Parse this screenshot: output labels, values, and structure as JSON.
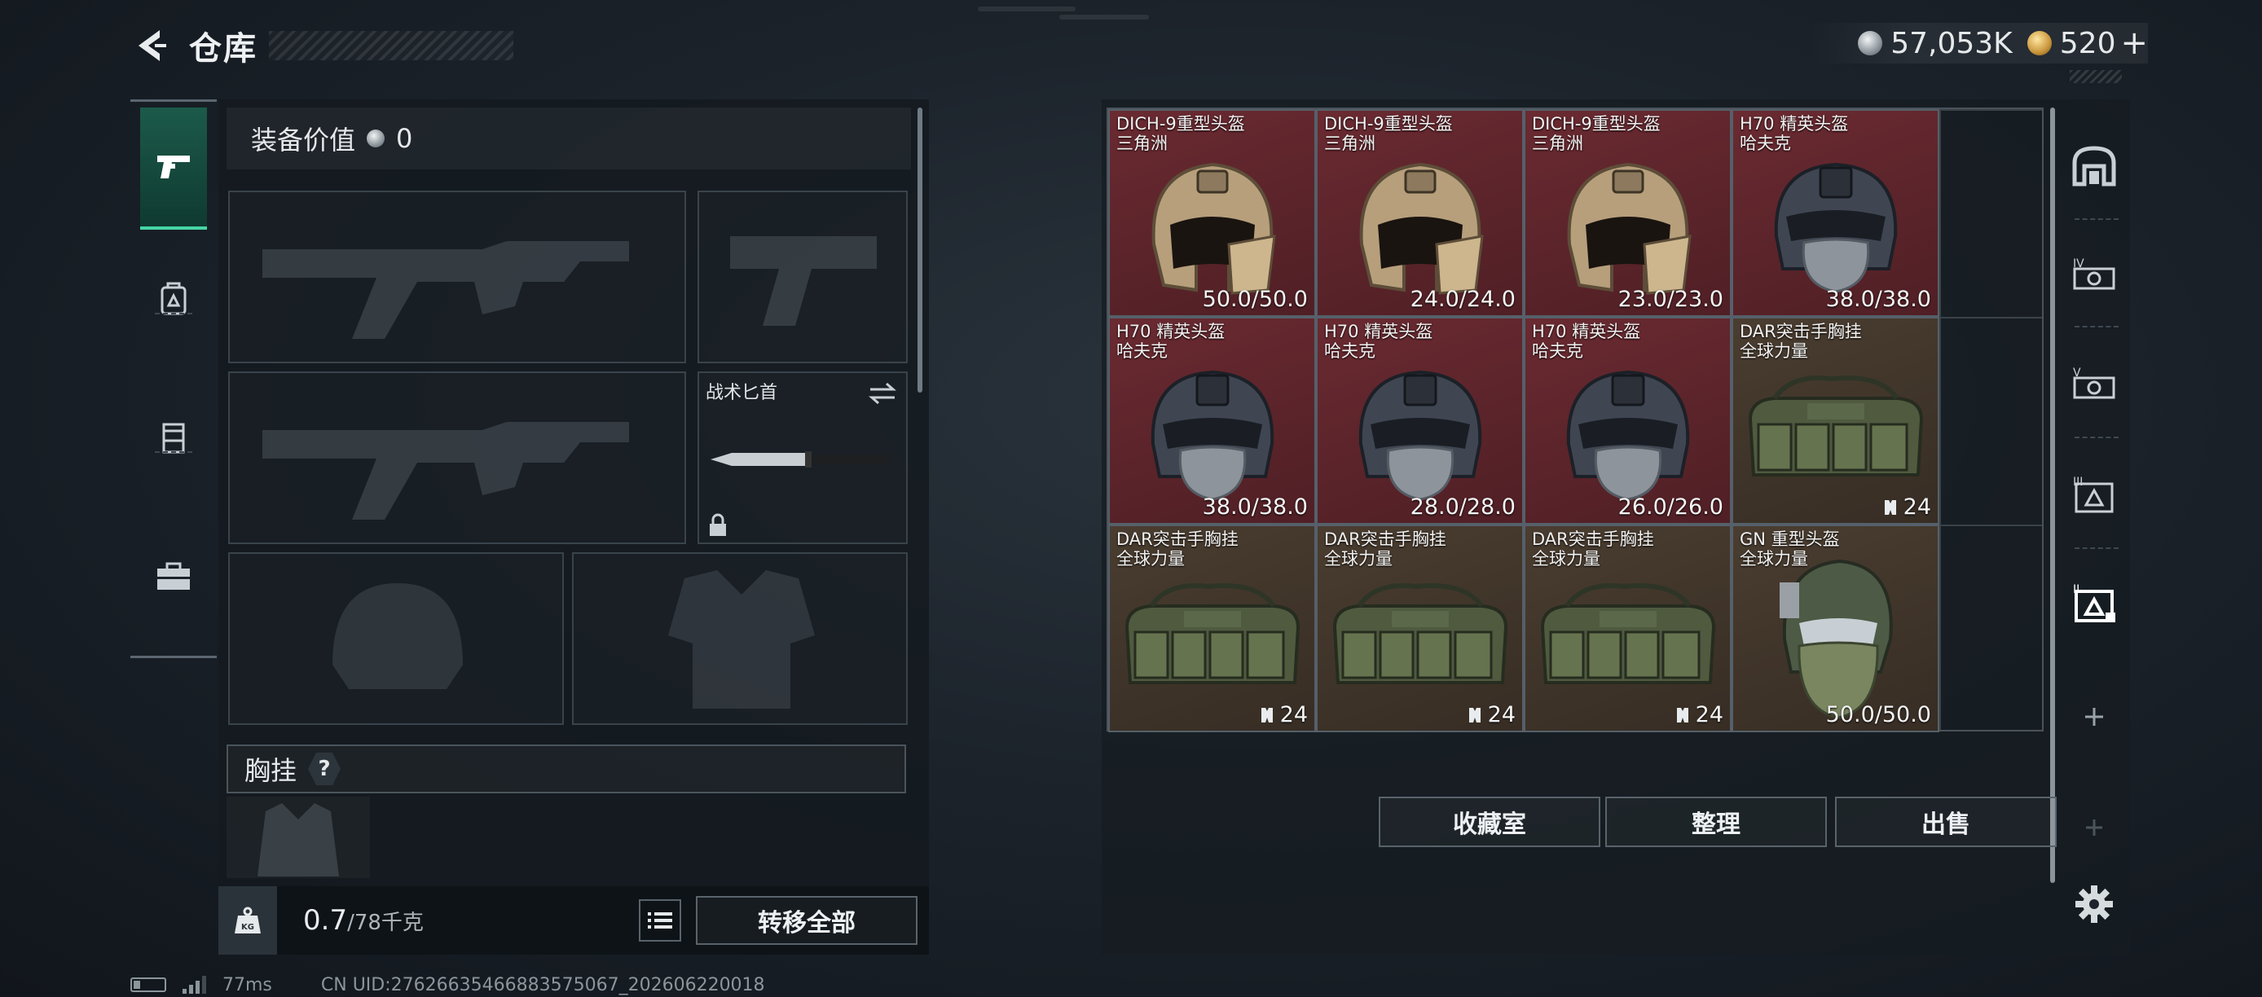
{
  "header": {
    "title": "仓库",
    "currency": {
      "silver": "57,053K",
      "gold": "520"
    },
    "plus_label": "+"
  },
  "loadout": {
    "equip_value_label": "装备价值",
    "equip_value": "0",
    "knife_label": "战术匕首",
    "chest_label": "胸挂",
    "help_label": "?",
    "weight_current": "0.7",
    "weight_max": "/78千克",
    "weight_icon_text": "KG",
    "transfer_all": "转移全部"
  },
  "stash": {
    "items": [
      {
        "name": "DICH-9重型头盔",
        "sub": "三角洲",
        "value": "50.0/50.0",
        "kind": "helmet-tan",
        "bg": "red",
        "qty_icon": false
      },
      {
        "name": "DICH-9重型头盔",
        "sub": "三角洲",
        "value": "24.0/24.0",
        "kind": "helmet-tan",
        "bg": "red",
        "qty_icon": false
      },
      {
        "name": "DICH-9重型头盔",
        "sub": "三角洲",
        "value": "23.0/23.0",
        "kind": "helmet-tan",
        "bg": "red",
        "qty_icon": false
      },
      {
        "name": "H70 精英头盔",
        "sub": "哈夫克",
        "value": "38.0/38.0",
        "kind": "helmet-dark",
        "bg": "red",
        "qty_icon": false
      },
      {
        "name": "H70 精英头盔",
        "sub": "哈夫克",
        "value": "38.0/38.0",
        "kind": "helmet-dark",
        "bg": "red",
        "qty_icon": false
      },
      {
        "name": "H70 精英头盔",
        "sub": "哈夫克",
        "value": "28.0/28.0",
        "kind": "helmet-dark",
        "bg": "red",
        "qty_icon": false
      },
      {
        "name": "H70 精英头盔",
        "sub": "哈夫克",
        "value": "26.0/26.0",
        "kind": "helmet-dark",
        "bg": "red",
        "qty_icon": false
      },
      {
        "name": "DAR突击手胸挂",
        "sub": "全球力量",
        "value": "24",
        "kind": "rig",
        "bg": "brown",
        "qty_icon": true
      },
      {
        "name": "DAR突击手胸挂",
        "sub": "全球力量",
        "value": "24",
        "kind": "rig",
        "bg": "brown",
        "qty_icon": true
      },
      {
        "name": "DAR突击手胸挂",
        "sub": "全球力量",
        "value": "24",
        "kind": "rig",
        "bg": "brown",
        "qty_icon": true
      },
      {
        "name": "DAR突击手胸挂",
        "sub": "全球力量",
        "value": "24",
        "kind": "rig",
        "bg": "brown",
        "qty_icon": true
      },
      {
        "name": "GN 重型头盔",
        "sub": "全球力量",
        "value": "50.0/50.0",
        "kind": "helmet-green",
        "bg": "brown",
        "qty_icon": false
      }
    ],
    "buttons": {
      "collection": "收藏室",
      "sort": "整理",
      "sell": "出售"
    }
  },
  "status": {
    "ping": "77ms",
    "uid": "CN UID:27626635466883575067_202606220018"
  },
  "colors": {
    "accent": "#47d6a6",
    "red_item": "#6a2a31",
    "brown_item": "#4a3d30"
  },
  "icons": [
    "back-arrow-icon",
    "silver-coin-icon",
    "gold-coin-icon",
    "pistol-icon",
    "backpack-icon",
    "armor-icon",
    "toolbox-icon",
    "swap-icon",
    "lock-icon",
    "weight-icon",
    "list-icon",
    "storage-icon",
    "gear-icon"
  ]
}
